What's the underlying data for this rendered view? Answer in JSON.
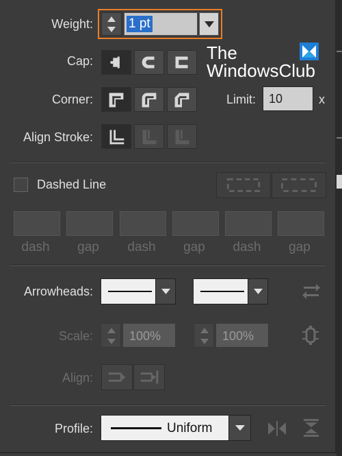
{
  "weight": {
    "label": "Weight:",
    "value": "1 pt"
  },
  "cap": {
    "label": "Cap:",
    "options": [
      "butt-cap",
      "round-cap",
      "projecting-cap"
    ],
    "selected": 0
  },
  "corner": {
    "label": "Corner:",
    "options": [
      "miter-join",
      "round-join",
      "bevel-join"
    ],
    "limit_label": "Limit:",
    "limit_value": "10",
    "limit_suffix": "x"
  },
  "align_stroke": {
    "label": "Align Stroke:",
    "options": [
      "align-center",
      "align-inside",
      "align-outside"
    ]
  },
  "dashed": {
    "label": "Dashed Line",
    "checked": false,
    "fields": [
      "dash",
      "gap",
      "dash",
      "gap",
      "dash",
      "gap"
    ]
  },
  "arrowheads": {
    "label": "Arrowheads:"
  },
  "scale": {
    "label": "Scale:",
    "start": "100%",
    "end": "100%"
  },
  "align": {
    "label": "Align:"
  },
  "profile": {
    "label": "Profile:",
    "value": "Uniform"
  },
  "watermark": {
    "line1": "The",
    "line2": "WindowsClub"
  },
  "colors": {
    "panel": "#3b3b3b",
    "focus": "#e87e2c",
    "selection": "#2a6fc9"
  }
}
